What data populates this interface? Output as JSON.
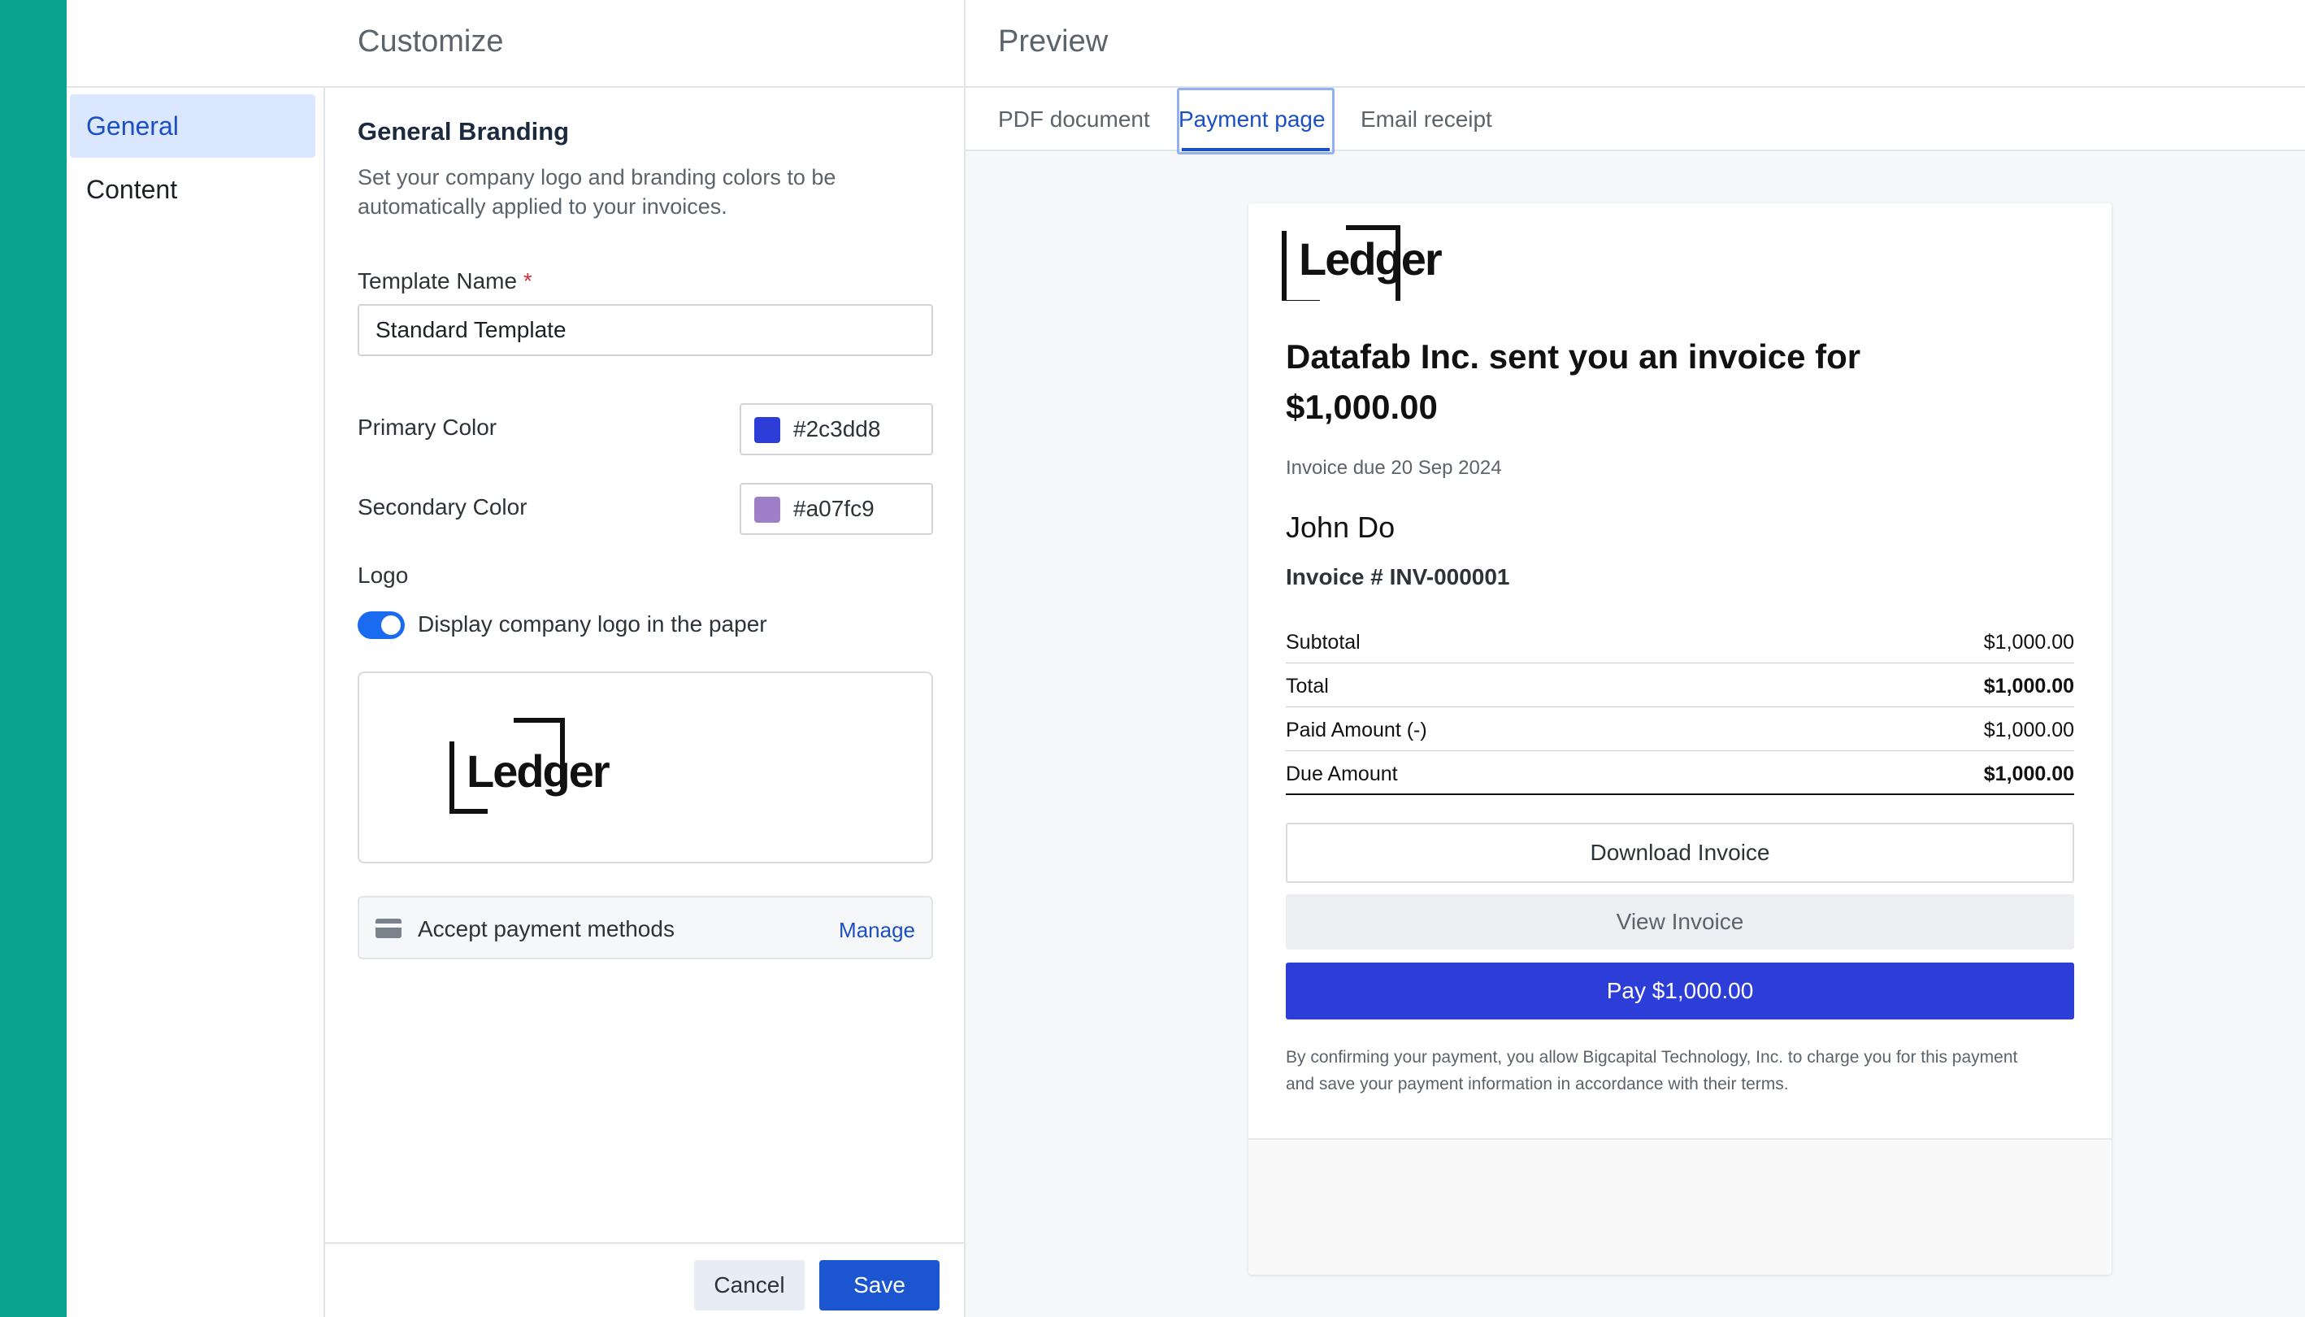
{
  "customize": {
    "title": "Customize",
    "nav": [
      {
        "label": "General"
      },
      {
        "label": "Content"
      }
    ],
    "section": {
      "title": "General Branding",
      "description": "Set your company logo and branding colors to be automatically applied to your invoices."
    },
    "template_name": {
      "label": "Template Name",
      "required_mark": "*",
      "value": "Standard Template"
    },
    "primary_color": {
      "label": "Primary Color",
      "value": "#2c3dd8"
    },
    "secondary_color": {
      "label": "Secondary Color",
      "value": "#a07fc9"
    },
    "logo": {
      "label": "Logo",
      "toggle_label": "Display company logo in the paper",
      "toggle_on": true,
      "brand_text": "Ledger"
    },
    "payment": {
      "label": "Accept payment methods",
      "action": "Manage",
      "icon": "credit-card-icon"
    },
    "footer": {
      "cancel_label": "Cancel",
      "save_label": "Save"
    }
  },
  "preview": {
    "title": "Preview",
    "tabs": [
      {
        "label": "PDF document"
      },
      {
        "label": "Payment page",
        "active": true
      },
      {
        "label": "Email receipt"
      }
    ],
    "invoice": {
      "brand_text": "Ledger",
      "headline": "Datafab Inc. sent you an invoice for $1,000.00",
      "due": "Invoice due 20 Sep 2024",
      "customer": "John Do",
      "number": "Invoice # INV-000001",
      "rows": [
        {
          "label": "Subtotal",
          "value": "$1,000.00"
        },
        {
          "label": "Total",
          "value": "$1,000.00"
        },
        {
          "label": "Paid Amount (-)",
          "value": "$1,000.00"
        },
        {
          "label": "Due Amount",
          "value": "$1,000.00"
        }
      ],
      "download_label": "Download Invoice",
      "view_label": "View Invoice",
      "pay_label": "Pay $1,000.00",
      "terms": "By confirming your payment, you allow Bigcapital Technology, Inc. to charge you for this payment and save your payment information in accordance with their terms."
    }
  },
  "colors": {
    "accent_strip": "#09a38f",
    "link": "#1b4fc4",
    "save_button": "#1b56d0",
    "pay_button": "#2c3dd8"
  }
}
